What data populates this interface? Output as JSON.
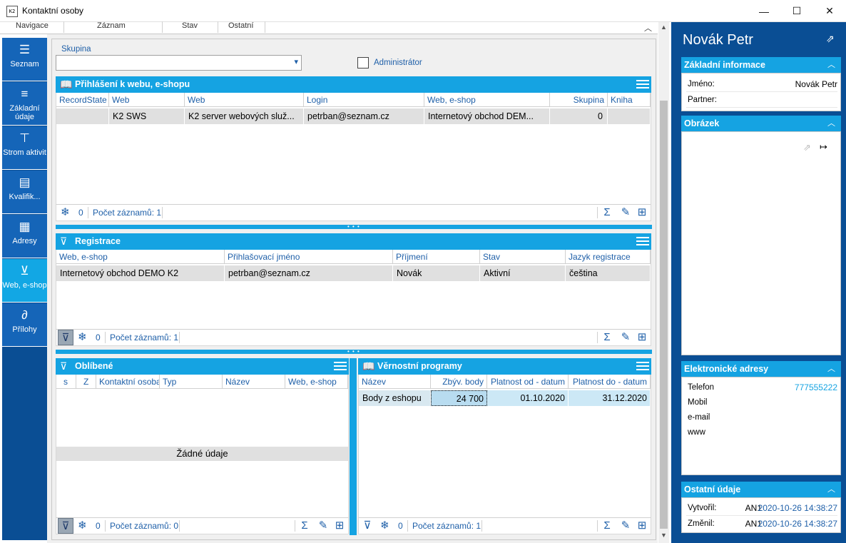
{
  "window": {
    "title": "Kontaktní osoby",
    "app_icon": "K2",
    "min": "—",
    "max": "☐",
    "close": "✕"
  },
  "menu": [
    "Navigace",
    "Záznam",
    "Stav",
    "Ostatní"
  ],
  "nav": [
    {
      "label": "Seznam",
      "icon": "list-icon"
    },
    {
      "label": "Základní údaje",
      "icon": "details-icon"
    },
    {
      "label": "Strom aktivit",
      "icon": "tree-icon"
    },
    {
      "label": "Kvalifik...",
      "icon": "qualification-icon"
    },
    {
      "label": "Adresy",
      "icon": "building-icon"
    },
    {
      "label": "Web, e-shop",
      "icon": "cart-icon"
    },
    {
      "label": "Přílohy",
      "icon": "paperclip-icon"
    }
  ],
  "filter": {
    "group_label": "Skupina",
    "group_value": "",
    "admin_label": "Administrátor",
    "admin_checked": false
  },
  "login_panel": {
    "title": "Přihlášení k webu, e-shopu",
    "columns": [
      "RecordState",
      "Web",
      "Web",
      "Login",
      "Web, e-shop",
      "Skupina",
      "Kniha"
    ],
    "rows": [
      [
        "",
        "K2 SWS",
        "K2 server webových služ...",
        "petrban@seznam.cz",
        "Internetový obchod DEM...",
        "0",
        ""
      ]
    ],
    "snow_count": "0",
    "record_count": "Počet záznamů: 1"
  },
  "registration_panel": {
    "title": "Registrace",
    "columns": [
      "Web, e-shop",
      "Přihlašovací jméno",
      "Příjmení",
      "Stav",
      "Jazyk registrace"
    ],
    "rows": [
      [
        "Internetový obchod DEMO K2",
        "petrban@seznam.cz",
        "Novák",
        "Aktivní",
        "čeština"
      ]
    ],
    "snow_count": "0",
    "record_count": "Počet záznamů: 1"
  },
  "favorites_panel": {
    "title": "Oblíbené",
    "columns": [
      "s",
      "Z",
      "Kontaktní osoba",
      "Typ",
      "Název",
      "Web, e-shop"
    ],
    "no_data": "Žádné údaje",
    "snow_count": "0",
    "record_count": "Počet záznamů: 0"
  },
  "loyalty_panel": {
    "title": "Věrnostní programy",
    "columns": [
      "Název",
      "Zbýv. body",
      "Platnost od - datum",
      "Platnost do - datum"
    ],
    "rows": [
      [
        "Body z eshopu",
        "24 700",
        "01.10.2020",
        "31.12.2020"
      ]
    ],
    "snow_count": "0",
    "record_count": "Počet záznamů: 1"
  },
  "right": {
    "name": "Novák Petr",
    "basic": {
      "title": "Základní informace",
      "jmeno_label": "Jméno:",
      "jmeno_value": "Novák Petr",
      "partner_label": "Partner:",
      "partner_value": ""
    },
    "image": {
      "title": "Obrázek"
    },
    "electronic": {
      "title": "Elektronické adresy",
      "telefon_label": "Telefon",
      "telefon_value": "777555222",
      "mobil_label": "Mobil",
      "email_label": "e-mail",
      "www_label": "www"
    },
    "other": {
      "title": "Ostatní údaje",
      "created_label": "Vytvořil:",
      "created_user": "AN1",
      "created_date": "2020-10-26 14:38:27",
      "changed_label": "Změnil:",
      "changed_user": "AN1",
      "changed_date": "2020-10-26 14:38:27"
    }
  },
  "colors": {
    "accent": "#15a3e2",
    "nav": "#1565b8",
    "nav_active": "#12a7e4",
    "dark": "#0a4e94",
    "link": "#1e5fa8"
  }
}
